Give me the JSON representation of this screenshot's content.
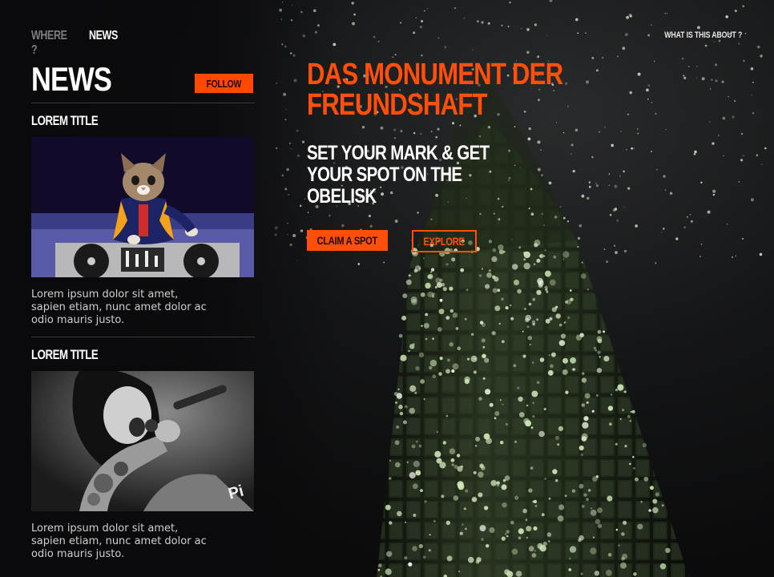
{
  "nav": {
    "where_label": "WHERE ?",
    "news_label": "NEWS",
    "about_label": "WHAT IS THIS ABOUT ?"
  },
  "news_panel": {
    "title": "NEWS",
    "follow_label": "FOLLOW",
    "items": [
      {
        "title": "LOREM TITLE",
        "image_icon": "cat-dj-photo",
        "text": "Lorem ipsum dolor sit amet, sapien etiam, nunc amet dolor ac odio mauris justo."
      },
      {
        "title": "LOREM TITLE",
        "image_icon": "singer-photo",
        "text": "Lorem ipsum dolor sit amet, sapien etiam, nunc amet dolor ac odio mauris justo."
      }
    ]
  },
  "hero": {
    "title": "DAS MONUMENT DER FREUNDSHAFT",
    "subtitle": "SET YOUR MARK & GET YOUR SPOT ON THE OBELISK",
    "claim_label": "CLAIM A SPOT",
    "explore_label": "EXPLORE"
  },
  "colors": {
    "accent": "#ff4f0a",
    "background": "#0e0e10",
    "muted_nav": "#7d7d7d",
    "body_text": "#cfcfcf",
    "divider": "#3a3a3a"
  }
}
